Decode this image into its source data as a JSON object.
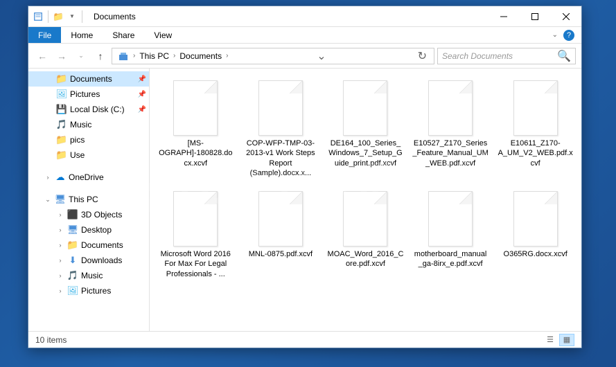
{
  "window": {
    "title": "Documents"
  },
  "ribbon": {
    "file": "File",
    "tabs": [
      "Home",
      "Share",
      "View"
    ]
  },
  "breadcrumb": {
    "items": [
      "This PC",
      "Documents"
    ]
  },
  "search": {
    "placeholder": "Search Documents"
  },
  "nav": {
    "quick_access": [
      {
        "label": "Documents",
        "icon": "folder",
        "pinned": true,
        "selected": true
      },
      {
        "label": "Pictures",
        "icon": "pictures",
        "pinned": true
      },
      {
        "label": "Local Disk (C:)",
        "icon": "disk",
        "pinned": true
      },
      {
        "label": "Music",
        "icon": "music",
        "pinned": false
      },
      {
        "label": "pics",
        "icon": "folder",
        "pinned": false
      },
      {
        "label": "Use",
        "icon": "folder",
        "pinned": false
      }
    ],
    "onedrive": {
      "label": "OneDrive"
    },
    "thispc": {
      "label": "This PC",
      "children": [
        {
          "label": "3D Objects",
          "icon": "3d"
        },
        {
          "label": "Desktop",
          "icon": "desktop"
        },
        {
          "label": "Documents",
          "icon": "folder"
        },
        {
          "label": "Downloads",
          "icon": "downloads"
        },
        {
          "label": "Music",
          "icon": "music"
        },
        {
          "label": "Pictures",
          "icon": "pictures"
        }
      ]
    }
  },
  "files": [
    {
      "name": "[MS-OGRAPH]-180828.docx.xcvf"
    },
    {
      "name": "COP-WFP-TMP-03-2013-v1 Work Steps Report (Sample).docx.x..."
    },
    {
      "name": "DE164_100_Series_Windows_7_Setup_Guide_print.pdf.xcvf"
    },
    {
      "name": "E10527_Z170_Series_Feature_Manual_UM_WEB.pdf.xcvf"
    },
    {
      "name": "E10611_Z170-A_UM_V2_WEB.pdf.xcvf"
    },
    {
      "name": "Microsoft Word 2016 For Max For Legal Professionals - ..."
    },
    {
      "name": "MNL-0875.pdf.xcvf"
    },
    {
      "name": "MOAC_Word_2016_Core.pdf.xcvf"
    },
    {
      "name": "motherboard_manual_ga-8irx_e.pdf.xcvf"
    },
    {
      "name": "O365RG.docx.xcvf"
    }
  ],
  "status": {
    "count": "10 items"
  }
}
